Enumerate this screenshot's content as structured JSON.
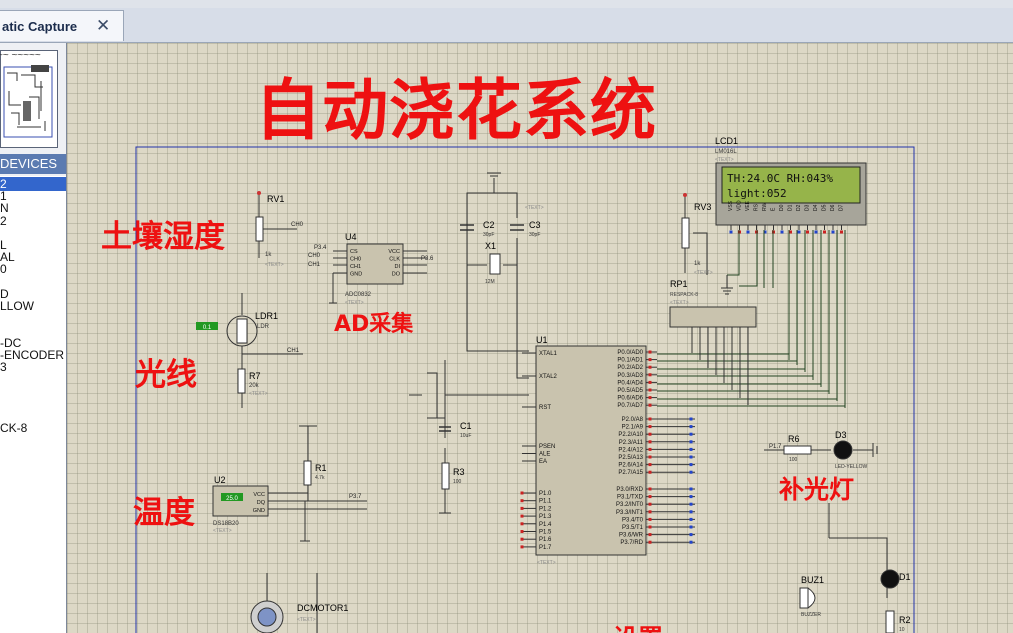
{
  "tab": {
    "title": "atic Capture",
    "close_glyph": "✕"
  },
  "left_panel": {
    "preview_label": "~~ ~~~~~",
    "devices_header": "DEVICES",
    "items": [
      "2",
      "1",
      "N",
      "2",
      "",
      "L",
      "AL",
      "0",
      "",
      "D",
      "LLOW",
      "",
      "",
      "-DC",
      "-ENCODER",
      "3",
      "",
      "",
      "",
      "",
      "CK-8"
    ]
  },
  "annotations": {
    "title": "自动浇花系统",
    "soil_humidity": "土壤湿度",
    "ad_acquisition": "AD采集",
    "light": "光线",
    "temperature": "温度",
    "fill_light": "补光灯",
    "setting": "设置"
  },
  "lcd": {
    "ref": "LCD1",
    "part": "LM016L",
    "line1": "TH:24.0C RH:043%",
    "line2": "light:052",
    "pins": [
      "VSS",
      "VDD",
      "VEE",
      "RS",
      "RW",
      "E",
      "D0",
      "D1",
      "D2",
      "D3",
      "D4",
      "D5",
      "D6",
      "D7"
    ]
  },
  "components": {
    "rv1": "RV1",
    "rv1_val": "1k",
    "rv3": "RV3",
    "rv3_val": "1k",
    "u4": "U4",
    "u4_part": "ADC0832",
    "u4_pins_left": [
      "CS",
      "CH0",
      "CH1",
      "GND"
    ],
    "u4_pins_right": [
      "VCC",
      "CLK",
      "DI",
      "DO"
    ],
    "ldr": "LDR1",
    "ldr_val": "LDR",
    "r7": "R7",
    "r7_val": "20k",
    "u2": "U2",
    "u2_part": "DS18B20",
    "u2_pins": [
      "VCC",
      "DQ",
      "GND"
    ],
    "u2_disp": "25.0",
    "r1": "R1",
    "r1_val": "4.7k",
    "c2": "C2",
    "c2_val": "30pF",
    "c3": "C3",
    "c3_val": "30pF",
    "x1": "X1",
    "x1_val": "12M",
    "c1": "C1",
    "c1_val": "10uF",
    "r3": "R3",
    "r3_val": "100",
    "u1": "U1",
    "rp1": "RP1",
    "rp1_part": "RESPACK-8",
    "r6": "R6",
    "r6_val": "100",
    "d3": "D3",
    "d3_part": "LED-YELLOW",
    "buz": "BUZ1",
    "buz_part": "BUZZER",
    "d1": "D1",
    "r2": "R2",
    "r2_val": "10",
    "motor": "DCMOTOR1",
    "text_tag": "<TEXT>"
  },
  "u1_pins": {
    "left_top": [
      "XTAL1",
      "XTAL2",
      "RST"
    ],
    "left_mid": [
      "PSEN",
      "ALE",
      "EA"
    ],
    "left_bot": [
      "P1.0",
      "P1.1",
      "P1.2",
      "P1.3",
      "P1.4",
      "P1.5",
      "P1.6",
      "P1.7"
    ],
    "right_p0": [
      "P0.0/AD0",
      "P0.1/AD1",
      "P0.2/AD2",
      "P0.3/AD3",
      "P0.4/AD4",
      "P0.5/AD5",
      "P0.6/AD6",
      "P0.7/AD7"
    ],
    "right_p2": [
      "P2.0/A8",
      "P2.1/A9",
      "P2.2/A10",
      "P2.3/A11",
      "P2.4/A12",
      "P2.5/A13",
      "P2.6/A14",
      "P2.7/A15"
    ],
    "right_p3": [
      "P3.0/RXD",
      "P3.1/TXD",
      "P3.2/INT0",
      "P3.3/INT1",
      "P3.4/T0",
      "P3.5/T1",
      "P3.6/WR",
      "P3.7/RD"
    ]
  },
  "nets": {
    "ch0": "CH0",
    "ch1": "CH1",
    "p37": "P3.7",
    "p17": "P1.7",
    "p34": "P3.4",
    "p36": "P3.6",
    "p16": "P1.6"
  }
}
